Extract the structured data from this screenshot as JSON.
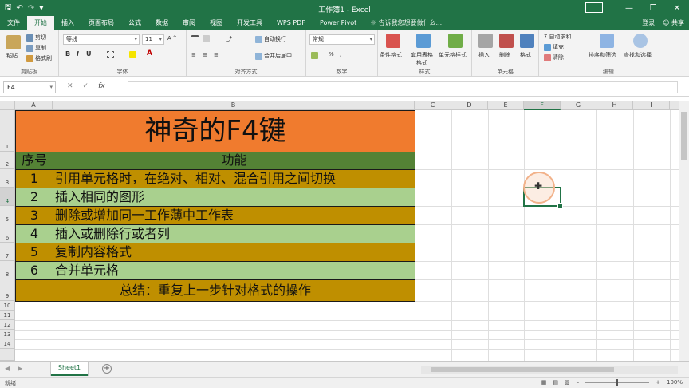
{
  "titlebar": {
    "title": "工作簿1 - Excel",
    "qat": [
      "save-icon",
      "undo-icon",
      "redo-icon",
      "customize-icon"
    ]
  },
  "tabs": [
    "文件",
    "开始",
    "插入",
    "页面布局",
    "公式",
    "数据",
    "审阅",
    "视图",
    "开发工具",
    "WPS PDF",
    "Power Pivot"
  ],
  "active_tab": "开始",
  "tell_me": "告诉我您想要做什么...",
  "tabs_right": {
    "login": "登录",
    "share": "共享"
  },
  "ribbon": {
    "clipboard": {
      "paste": "粘贴",
      "cut": "剪切",
      "copy": "复制",
      "format_painter": "格式刷",
      "label": "剪贴板"
    },
    "font": {
      "name": "等线",
      "size": "11",
      "bold": "B",
      "italic": "I",
      "underline": "U",
      "label": "字体"
    },
    "alignment": {
      "wrap": "自动换行",
      "merge": "合并后居中",
      "label": "对齐方式"
    },
    "number": {
      "format": "常规",
      "percent": "%",
      "comma": ",",
      "label": "数字"
    },
    "styles": {
      "conditional": "条件格式",
      "table": "套用表格格式",
      "cell": "单元格样式",
      "label": "样式"
    },
    "cells": {
      "insert": "插入",
      "delete": "删除",
      "format": "格式",
      "label": "单元格"
    },
    "editing": {
      "autosum": "自动求和",
      "fill": "填充",
      "clear": "清除",
      "sort": "排序和筛选",
      "find": "查找和选择",
      "label": "编辑"
    }
  },
  "formula_bar": {
    "name_box": "F4",
    "cancel": "✕",
    "enter": "✓",
    "fx": "fx",
    "value": ""
  },
  "columns": [
    "A",
    "B",
    "C",
    "D",
    "E",
    "F",
    "G",
    "H",
    "I"
  ],
  "active_column": "F",
  "rows": [
    "1",
    "2",
    "3",
    "4",
    "5",
    "6",
    "7",
    "8",
    "9",
    "10",
    "11",
    "12",
    "13",
    "14"
  ],
  "active_row": "4",
  "table": {
    "title": "神奇的F4键",
    "header_num": "序号",
    "header_func": "功能",
    "items": [
      {
        "num": "1",
        "text": "引用单元格时，在绝对、相对、混合引用之间切换"
      },
      {
        "num": "2",
        "text": "插入相同的图形"
      },
      {
        "num": "3",
        "text": "删除或增加同一工作薄中工作表"
      },
      {
        "num": "4",
        "text": "插入或删除行或者列"
      },
      {
        "num": "5",
        "text": "复制内容格式"
      },
      {
        "num": "6",
        "text": "合并单元格"
      }
    ],
    "summary": "总结：重复上一步针对格式的操作"
  },
  "colors": {
    "excel_green": "#217346",
    "title_fill": "#f07b2e",
    "header_fill": "#548235",
    "gold_fill": "#bf8f00",
    "light_green_fill": "#a9d08e"
  },
  "sheets": [
    "Sheet1"
  ],
  "status": {
    "ready": "就绪",
    "zoom": "100%"
  }
}
